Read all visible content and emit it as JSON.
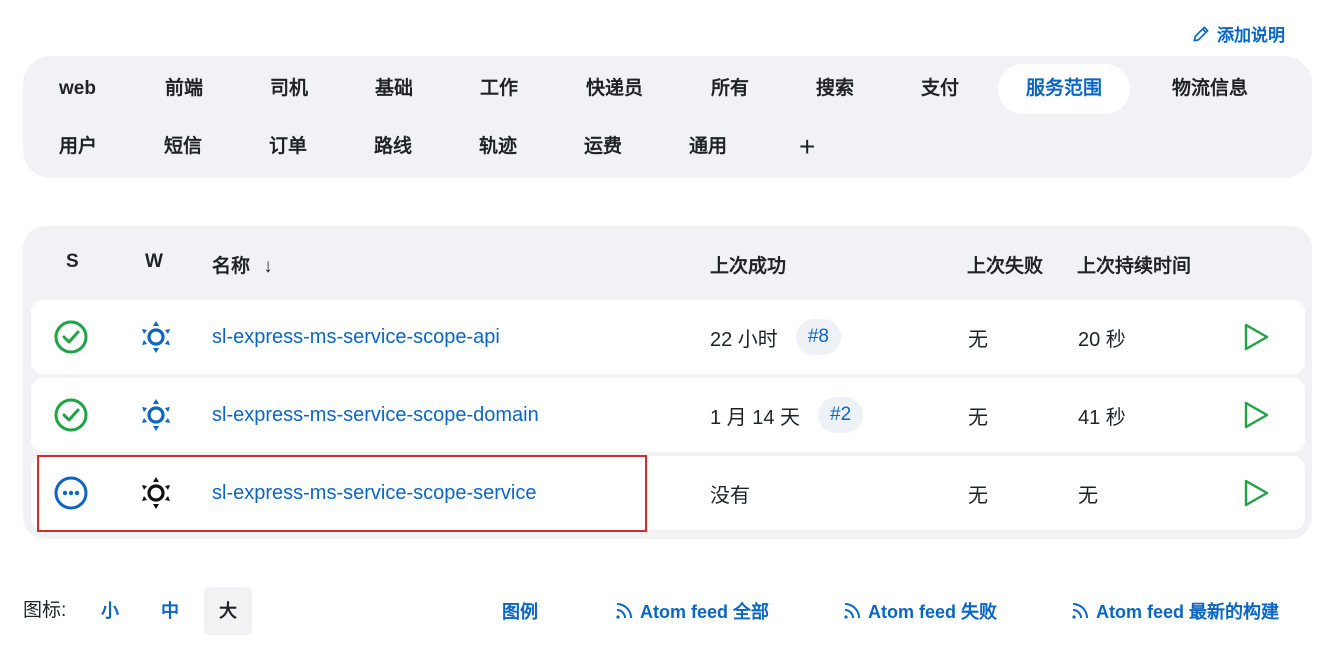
{
  "header": {
    "add_description_label": "添加说明"
  },
  "tabs": [
    {
      "label": "web"
    },
    {
      "label": "前端"
    },
    {
      "label": "司机"
    },
    {
      "label": "基础"
    },
    {
      "label": "工作"
    },
    {
      "label": "快递员"
    },
    {
      "label": "所有"
    },
    {
      "label": "搜索"
    },
    {
      "label": "支付"
    },
    {
      "label": "服务范围",
      "active": true
    },
    {
      "label": "物流信息"
    },
    {
      "label": "用户"
    },
    {
      "label": "短信"
    },
    {
      "label": "订单"
    },
    {
      "label": "路线"
    },
    {
      "label": "轨迹"
    },
    {
      "label": "运费"
    },
    {
      "label": "通用"
    },
    {
      "label": "+"
    }
  ],
  "table": {
    "headers": {
      "s": "S",
      "w": "W",
      "name": "名称",
      "sort_arrow": "↓",
      "last_success": "上次成功",
      "last_failure": "上次失败",
      "last_duration": "上次持续时间"
    },
    "rows": [
      {
        "status": "success",
        "weather": "sunny",
        "name": "sl-express-ms-service-scope-api",
        "last_success": "22 小时",
        "build": "#8",
        "last_failure": "无",
        "duration": "20 秒"
      },
      {
        "status": "success",
        "weather": "sunny",
        "name": "sl-express-ms-service-scope-domain",
        "last_success": "1 月 14 天",
        "build": "#2",
        "last_failure": "无",
        "duration": "41 秒"
      },
      {
        "status": "not-built",
        "weather": "sunny-black",
        "name": "sl-express-ms-service-scope-service",
        "last_success": "没有",
        "build": "",
        "last_failure": "无",
        "duration": "无"
      }
    ]
  },
  "footer": {
    "icon_label": "图标:",
    "sizes": [
      {
        "label": "小"
      },
      {
        "label": "中"
      },
      {
        "label": "大",
        "active": true
      }
    ],
    "legend": "图例",
    "feeds": [
      {
        "label": "Atom feed 全部"
      },
      {
        "label": "Atom feed 失败"
      },
      {
        "label": "Atom feed 最新的构建"
      }
    ]
  },
  "colors": {
    "accent": "#0b66c3",
    "success": "#1ea446",
    "highlight": "#d92b2b",
    "panel": "#f2f2f6"
  }
}
